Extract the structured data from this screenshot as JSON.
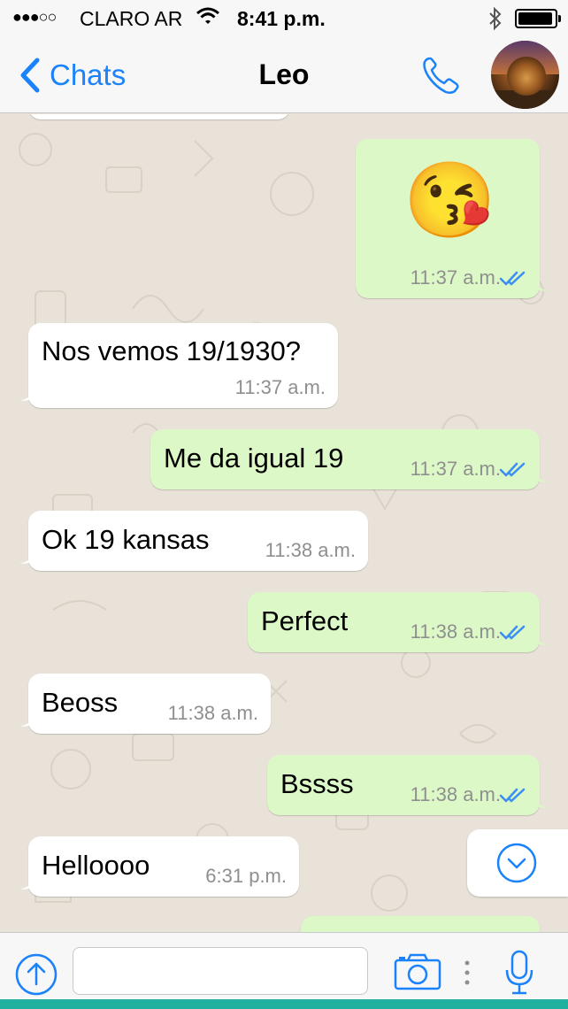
{
  "status_bar": {
    "signal": "●●●○○",
    "carrier": "CLARO AR",
    "time": "8:41 p.m."
  },
  "nav": {
    "back_label": "Chats",
    "contact_name": "Leo",
    "icons": {
      "back": "chevron-left-icon",
      "call": "phone-icon",
      "avatar": "lion-photo"
    }
  },
  "messages": [
    {
      "direction": "out",
      "type": "emoji",
      "text": "😘",
      "time": "11:37 a.m.",
      "read": true
    },
    {
      "direction": "in",
      "text": "Nos vemos 19/1930?",
      "time": "11:37 a.m."
    },
    {
      "direction": "out",
      "text": "Me da igual 19",
      "time": "11:37 a.m.",
      "read": true
    },
    {
      "direction": "in",
      "text": "Ok 19 kansas",
      "time": "11:38 a.m."
    },
    {
      "direction": "out",
      "text": "Perfect",
      "time": "11:38 a.m.",
      "read": true
    },
    {
      "direction": "in",
      "text": "Beoss",
      "time": "11:38 a.m."
    },
    {
      "direction": "out",
      "text": "Bssss",
      "time": "11:38 a.m.",
      "read": true
    },
    {
      "direction": "in",
      "text": "Helloooo",
      "time": "6:31 p.m."
    }
  ],
  "input_bar": {
    "placeholder": "",
    "icons": [
      "upload-arrow-icon",
      "camera-icon",
      "more-dots-icon",
      "microphone-icon"
    ]
  },
  "colors": {
    "accent": "#1a82fb",
    "outgoing_bubble": "#dcf8c6",
    "incoming_bubble": "#ffffff",
    "read_ticks": "#3a8ef6",
    "chat_background": "#e8e2d9"
  }
}
